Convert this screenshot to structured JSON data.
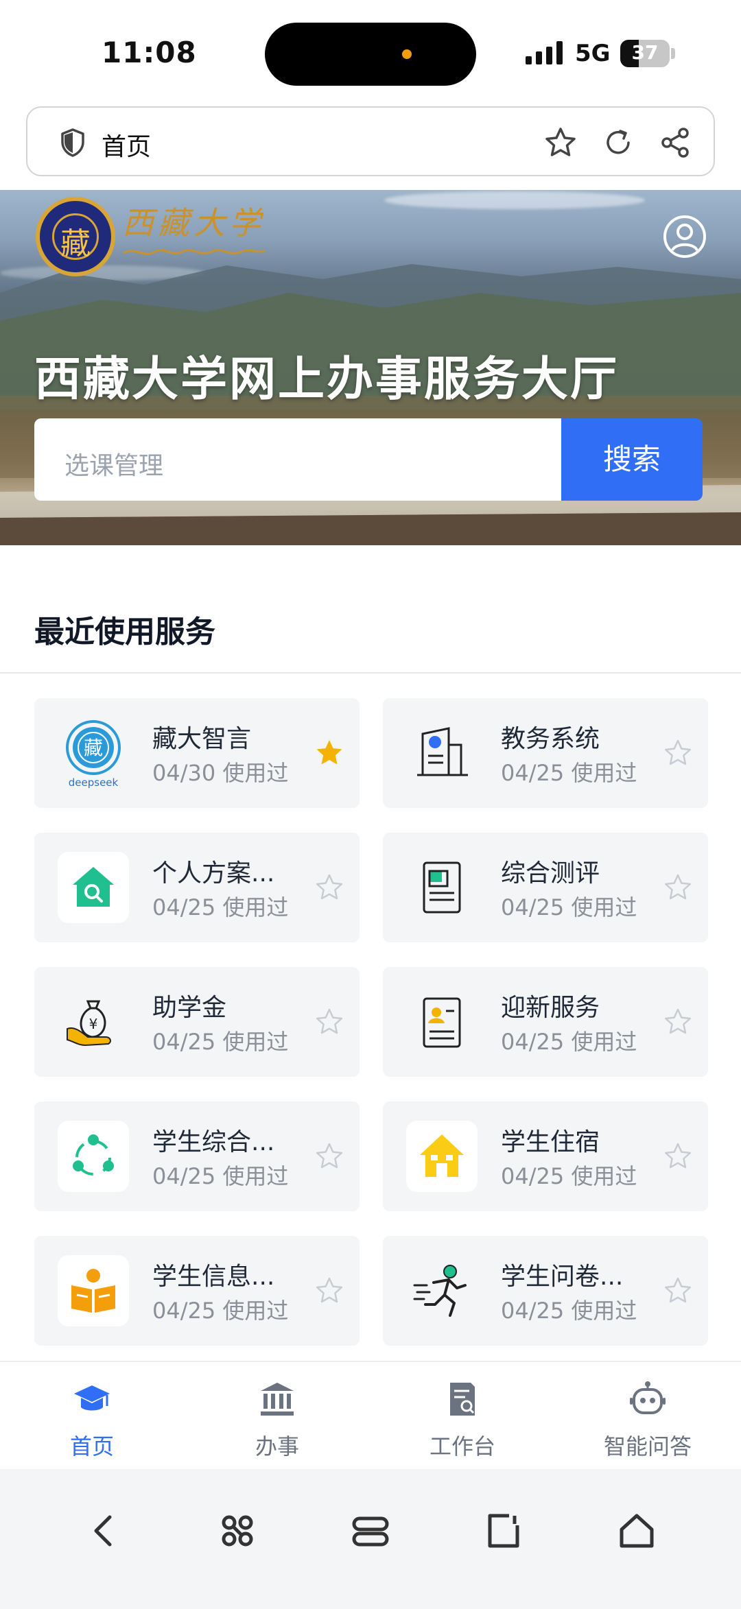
{
  "status_bar": {
    "time": "11:08",
    "network": "5G",
    "battery": "37",
    "battery_level": 0.37
  },
  "browser": {
    "page_title": "首页"
  },
  "hero": {
    "logo_name": "西藏大学",
    "title": "西藏大学网上办事服务大厅",
    "search_placeholder": "选课管理",
    "search_button": "搜索"
  },
  "recent": {
    "title": "最近使用服务",
    "items": [
      {
        "name": "藏大智言",
        "date": "04/30 使用过",
        "favorite": true,
        "icon": "deepseek-logo-icon",
        "icon_label": "deepseek"
      },
      {
        "name": "教务系统",
        "date": "04/25 使用过",
        "favorite": false,
        "icon": "academic-affairs-icon"
      },
      {
        "name": "个人方案...",
        "date": "04/25 使用过",
        "favorite": false,
        "icon": "house-search-icon"
      },
      {
        "name": "综合测评",
        "date": "04/25 使用过",
        "favorite": false,
        "icon": "evaluation-document-icon"
      },
      {
        "name": "助学金",
        "date": "04/25 使用过",
        "favorite": false,
        "icon": "money-bag-icon"
      },
      {
        "name": "迎新服务",
        "date": "04/25 使用过",
        "favorite": false,
        "icon": "welcome-card-icon"
      },
      {
        "name": "学生综合...",
        "date": "04/25 使用过",
        "favorite": false,
        "icon": "people-circle-icon"
      },
      {
        "name": "学生住宿",
        "date": "04/25 使用过",
        "favorite": false,
        "icon": "dormitory-house-icon"
      },
      {
        "name": "学生信息...",
        "date": "04/25 使用过",
        "favorite": false,
        "icon": "student-book-icon"
      },
      {
        "name": "学生问卷...",
        "date": "04/25 使用过",
        "favorite": false,
        "icon": "running-person-icon"
      }
    ]
  },
  "tabs": [
    {
      "label": "首页",
      "icon": "graduation-cap-icon",
      "active": true
    },
    {
      "label": "办事",
      "icon": "bank-building-icon",
      "active": false
    },
    {
      "label": "工作台",
      "icon": "document-search-icon",
      "active": false
    },
    {
      "label": "智能问答",
      "icon": "robot-icon",
      "active": false
    }
  ],
  "colors": {
    "accent": "#2f6ef5",
    "favorite": "#f5b301",
    "card_bg": "#f4f5f7",
    "green": "#1fbf8f",
    "orange": "#f59e0b",
    "yellow": "#facc15"
  }
}
